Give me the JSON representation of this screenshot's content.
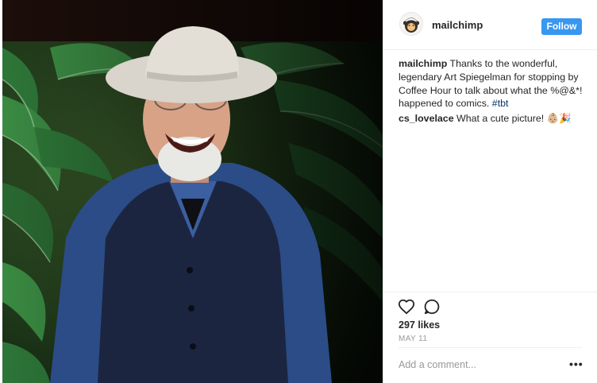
{
  "post": {
    "username": "mailchimp",
    "follow_label": "Follow",
    "avatar_icon": "mailchimp-freddie-logo",
    "caption": {
      "username": "mailchimp",
      "text": " Thanks to the wonderful, legendary Art Spiegelman for stopping by Coffee Hour to talk about what the %@&*! happened to comics. ",
      "hashtag": "#tbt"
    },
    "comments": [
      {
        "username": "cs_lovelace",
        "text": " What a cute picture! ",
        "emoji": "👶🏼🎉"
      }
    ],
    "likes": "297 likes",
    "date": "MAY 11",
    "add_comment_placeholder": "Add a comment...",
    "more_label": "•••",
    "icons": {
      "like": "heart-icon",
      "comment": "comment-icon"
    }
  },
  "colors": {
    "follow": "#3897f0",
    "hashtag": "#003569",
    "muted": "#999999",
    "text": "#262626"
  }
}
